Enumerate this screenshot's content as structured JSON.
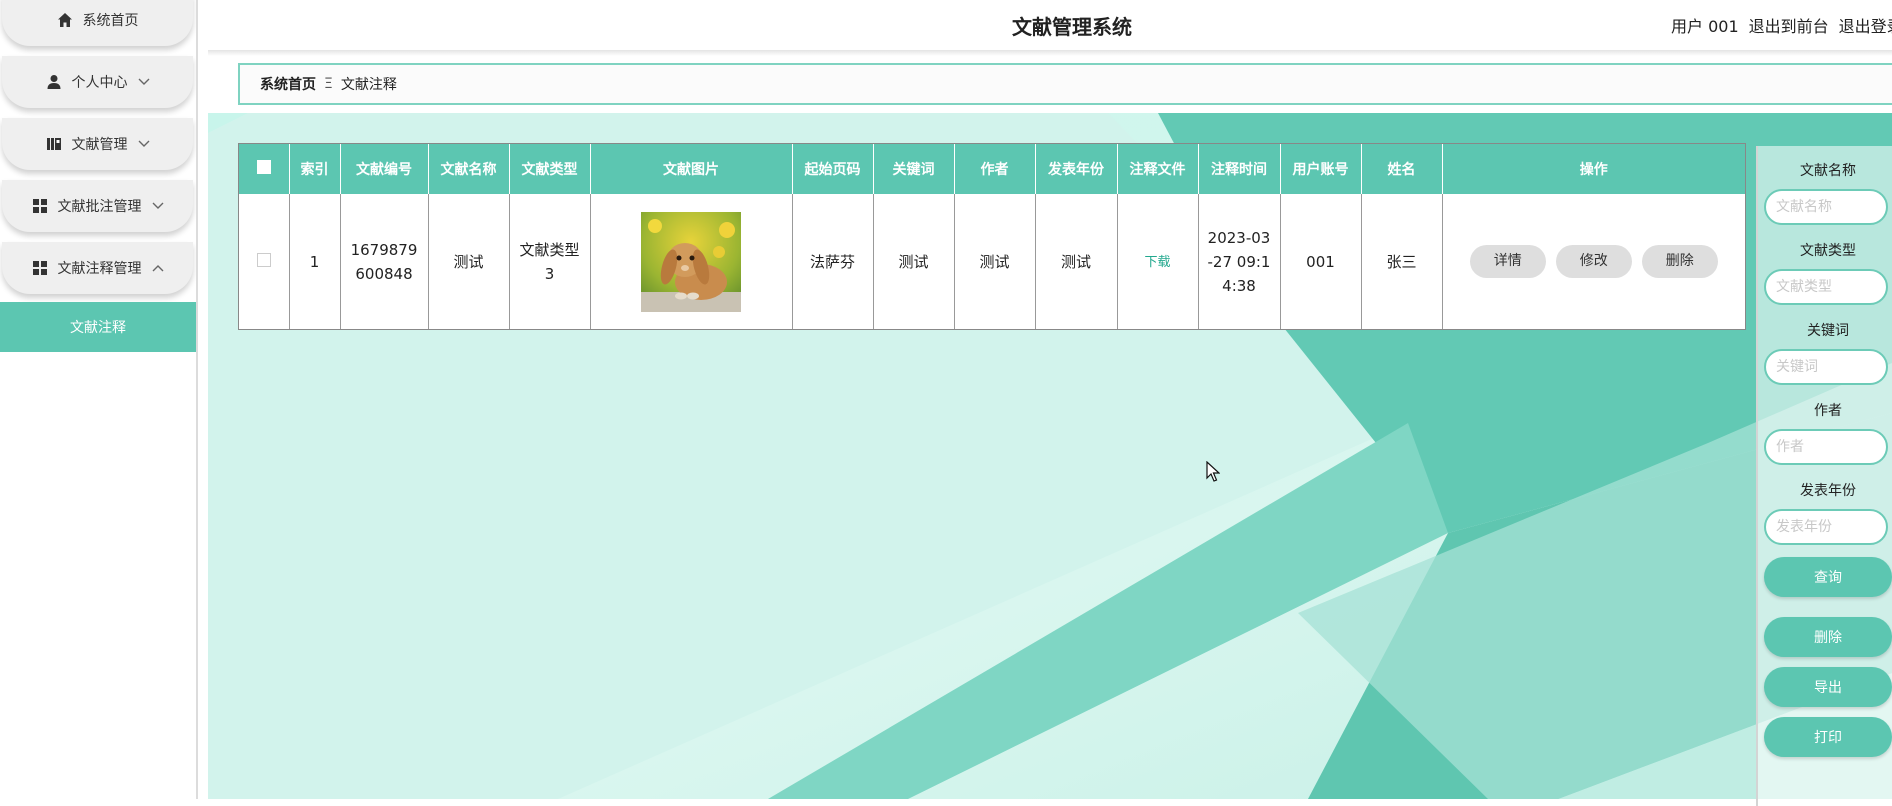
{
  "header": {
    "title": "文献管理系统",
    "user": "用户 001",
    "to_front": "退出到前台",
    "logout": "退出登录"
  },
  "sidebar": {
    "items": [
      {
        "label": "系统首页",
        "icon": "home-icon",
        "chevron": ""
      },
      {
        "label": "个人中心",
        "icon": "user-icon",
        "chevron": "chevron-down-icon"
      },
      {
        "label": "文献管理",
        "icon": "book-icon",
        "chevron": "chevron-down-icon"
      },
      {
        "label": "文献批注管理",
        "icon": "grid-icon",
        "chevron": "chevron-down-icon"
      },
      {
        "label": "文献注释管理",
        "icon": "grid-icon",
        "chevron": "chevron-up-icon"
      }
    ],
    "active_sub": "文献注释"
  },
  "breadcrumb": {
    "home": "系统首页",
    "separator": "Ξ",
    "current": "文献注释"
  },
  "table": {
    "columns": [
      "索引",
      "文献编号",
      "文献名称",
      "文献类型",
      "文献图片",
      "起始页码",
      "关键词",
      "作者",
      "发表年份",
      "注释文件",
      "注释时间",
      "用户账号",
      "姓名",
      "操作"
    ],
    "rows": [
      {
        "index": "1",
        "doc_no": "1679879600848",
        "doc_name": "测试",
        "doc_type": "文献类型3",
        "image": "rabbit-photo",
        "start_page": "法萨芬",
        "keyword": "测试",
        "author": "测试",
        "year": "测试",
        "file_link": "下载",
        "annot_time": "2023-03-27 09:14:38",
        "account": "001",
        "name": "张三",
        "actions": {
          "detail": "详情",
          "edit": "修改",
          "delete": "删除"
        }
      }
    ]
  },
  "search_panel": {
    "fields": [
      {
        "label": "文献名称",
        "placeholder": "文献名称"
      },
      {
        "label": "文献类型",
        "placeholder": "文献类型"
      },
      {
        "label": "关键词",
        "placeholder": "关键词"
      },
      {
        "label": "作者",
        "placeholder": "作者"
      },
      {
        "label": "发表年份",
        "placeholder": "发表年份"
      }
    ],
    "query_button": "查询",
    "delete_button": "删除",
    "export_button": "导出",
    "print_button": "打印"
  },
  "colors": {
    "accent": "#5cc6b1",
    "accent_light": "#c8f4ea",
    "accent_dark": "#4fb9a2"
  }
}
